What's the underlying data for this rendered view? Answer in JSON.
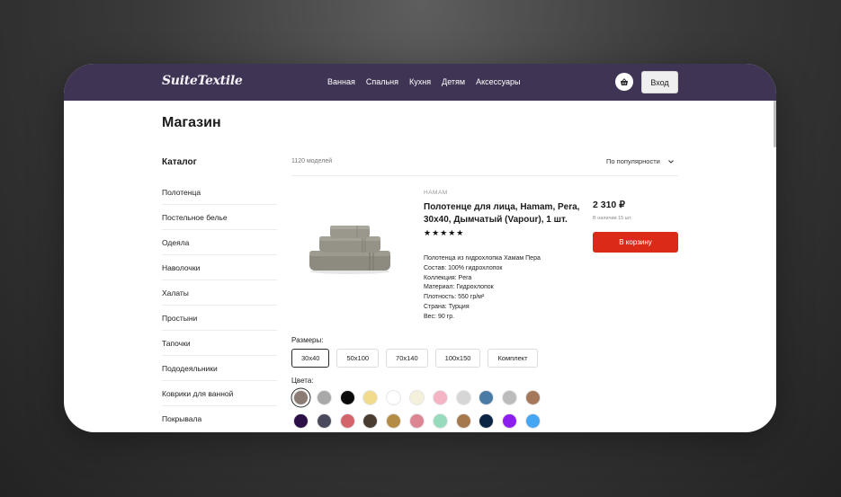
{
  "header": {
    "logo": "SuiteTextile",
    "nav": [
      "Ванная",
      "Спальня",
      "Кухня",
      "Детям",
      "Аксессуары"
    ],
    "cart_icon": "basket-icon",
    "login_label": "Вход",
    "bg_color": "#3f3453"
  },
  "page": {
    "title": "Магазин"
  },
  "catalog": {
    "title": "Каталог",
    "items": [
      "Полотенца",
      "Постельное белье",
      "Одеяла",
      "Наволочки",
      "Халаты",
      "Простыни",
      "Тапочки",
      "Пододеяльники",
      "Коврики для ванной",
      "Покрывала"
    ]
  },
  "listing": {
    "count": "1120 моделей",
    "sort_label": "По популярности"
  },
  "product": {
    "brand": "HAMAM",
    "title": "Полотенце для лица, Hamam, Pera, 30x40, Дымчатый (Vapour), 1 шт.",
    "stars": "★★★★★",
    "rating": 5,
    "desc": [
      "Полотенца из гидрохлопка Хамам Пера",
      "Состав: 100% гидрохлопок",
      "Коллекция: Pera",
      "Материал: Гидрохлопок",
      "Плотность: 550 гр/м²",
      "Страна: Турция",
      "Вес: 90 гр."
    ],
    "price": "2 310 ₽",
    "stock": "В наличии 15 шт.",
    "buy_label": "В корзину",
    "buy_color": "#dc2a19"
  },
  "sizes": {
    "label": "Размеры:",
    "options": [
      "30x40",
      "50x100",
      "70x140",
      "100x150",
      "Комплект"
    ],
    "selected": "30x40"
  },
  "colors": {
    "label": "Цвета:",
    "row1": [
      "#8a7c74",
      "#a9a9a9",
      "#0a0a0a",
      "#f0dc8c",
      "#ffffff",
      "#f4f0dc",
      "#f4b4c4",
      "#d6d6d6",
      "#4a7aa6",
      "#bcbcbc",
      "#a6785a"
    ],
    "row2": [
      "#2c0f46",
      "#4a4a5e",
      "#d4646c",
      "#4a3c30",
      "#b48c46",
      "#dc8694",
      "#96dcbc",
      "#a6784e",
      "#0c2444",
      "#8c1ef0",
      "#46a6f4"
    ]
  }
}
